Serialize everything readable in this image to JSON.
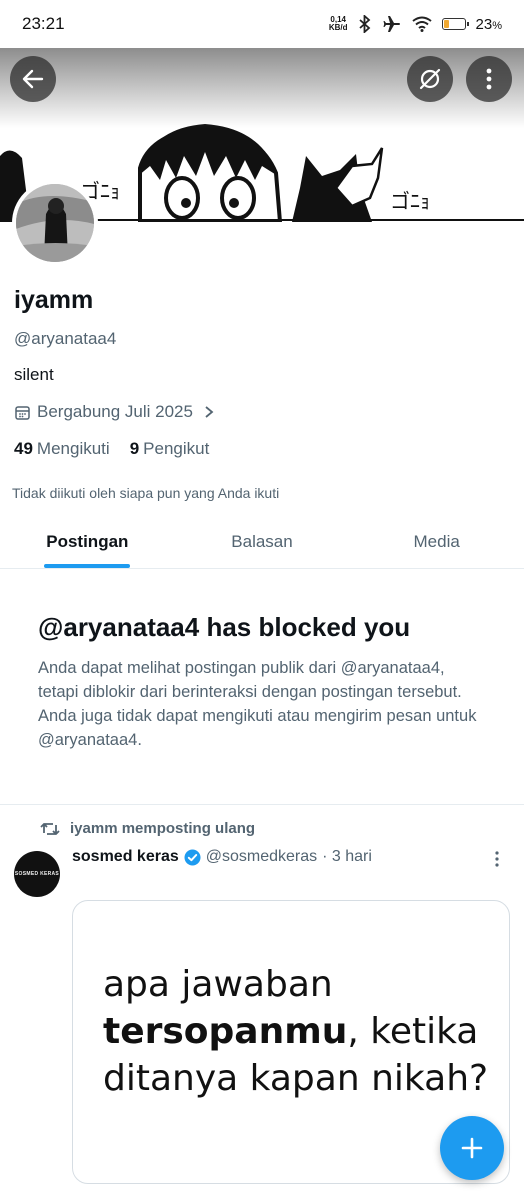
{
  "status_bar": {
    "time": "23:21",
    "net_speed_value": "0,14",
    "net_speed_unit": "KB/d",
    "battery_percent": "23",
    "battery_pct_symbol": "%",
    "battery_level": 0.23,
    "battery_color": "#f0a830"
  },
  "header": {
    "back_icon": "arrow-left-icon",
    "grok_icon": "grok-icon",
    "more_icon": "more-vertical-icon"
  },
  "banner": {
    "manga_text_left": "ゴﾆｮ",
    "manga_text_right": "ゴﾆｮ"
  },
  "profile": {
    "name": "iyamm",
    "handle": "@aryanataa4",
    "bio": "silent",
    "joined": "Bergabung Juli 2025",
    "following_count": "49",
    "following_label": "Mengikuti",
    "followers_count": "9",
    "followers_label": "Pengikut",
    "not_followed_note": "Tidak diikuti oleh siapa pun yang Anda ikuti"
  },
  "tabs": [
    {
      "label": "Postingan",
      "active": true
    },
    {
      "label": "Balasan",
      "active": false
    },
    {
      "label": "Media",
      "active": false
    }
  ],
  "blocked": {
    "title": "@aryanataa4 has blocked you",
    "text": "Anda dapat melihat postingan publik dari @aryanataa4, tetapi diblokir dari berinteraksi dengan postingan tersebut. Anda juga tidak dapat mengikuti atau mengirim pesan untuk @aryanataa4."
  },
  "post": {
    "repost_label": "iyamm memposting ulang",
    "author_name": "sosmed keras",
    "author_handle": "@sosmedkeras",
    "time": "· 3 hari",
    "avatar_text": "SOSMED KERAS",
    "card_line1": "apa jawaban",
    "card_line2_bold": "tersopanmu",
    "card_line2_rest": ", ketika",
    "card_line3": "ditanya kapan nikah?"
  },
  "fab": {
    "icon": "plus-icon"
  },
  "colors": {
    "accent": "#1d9bf0",
    "secondary_text": "#536471"
  }
}
